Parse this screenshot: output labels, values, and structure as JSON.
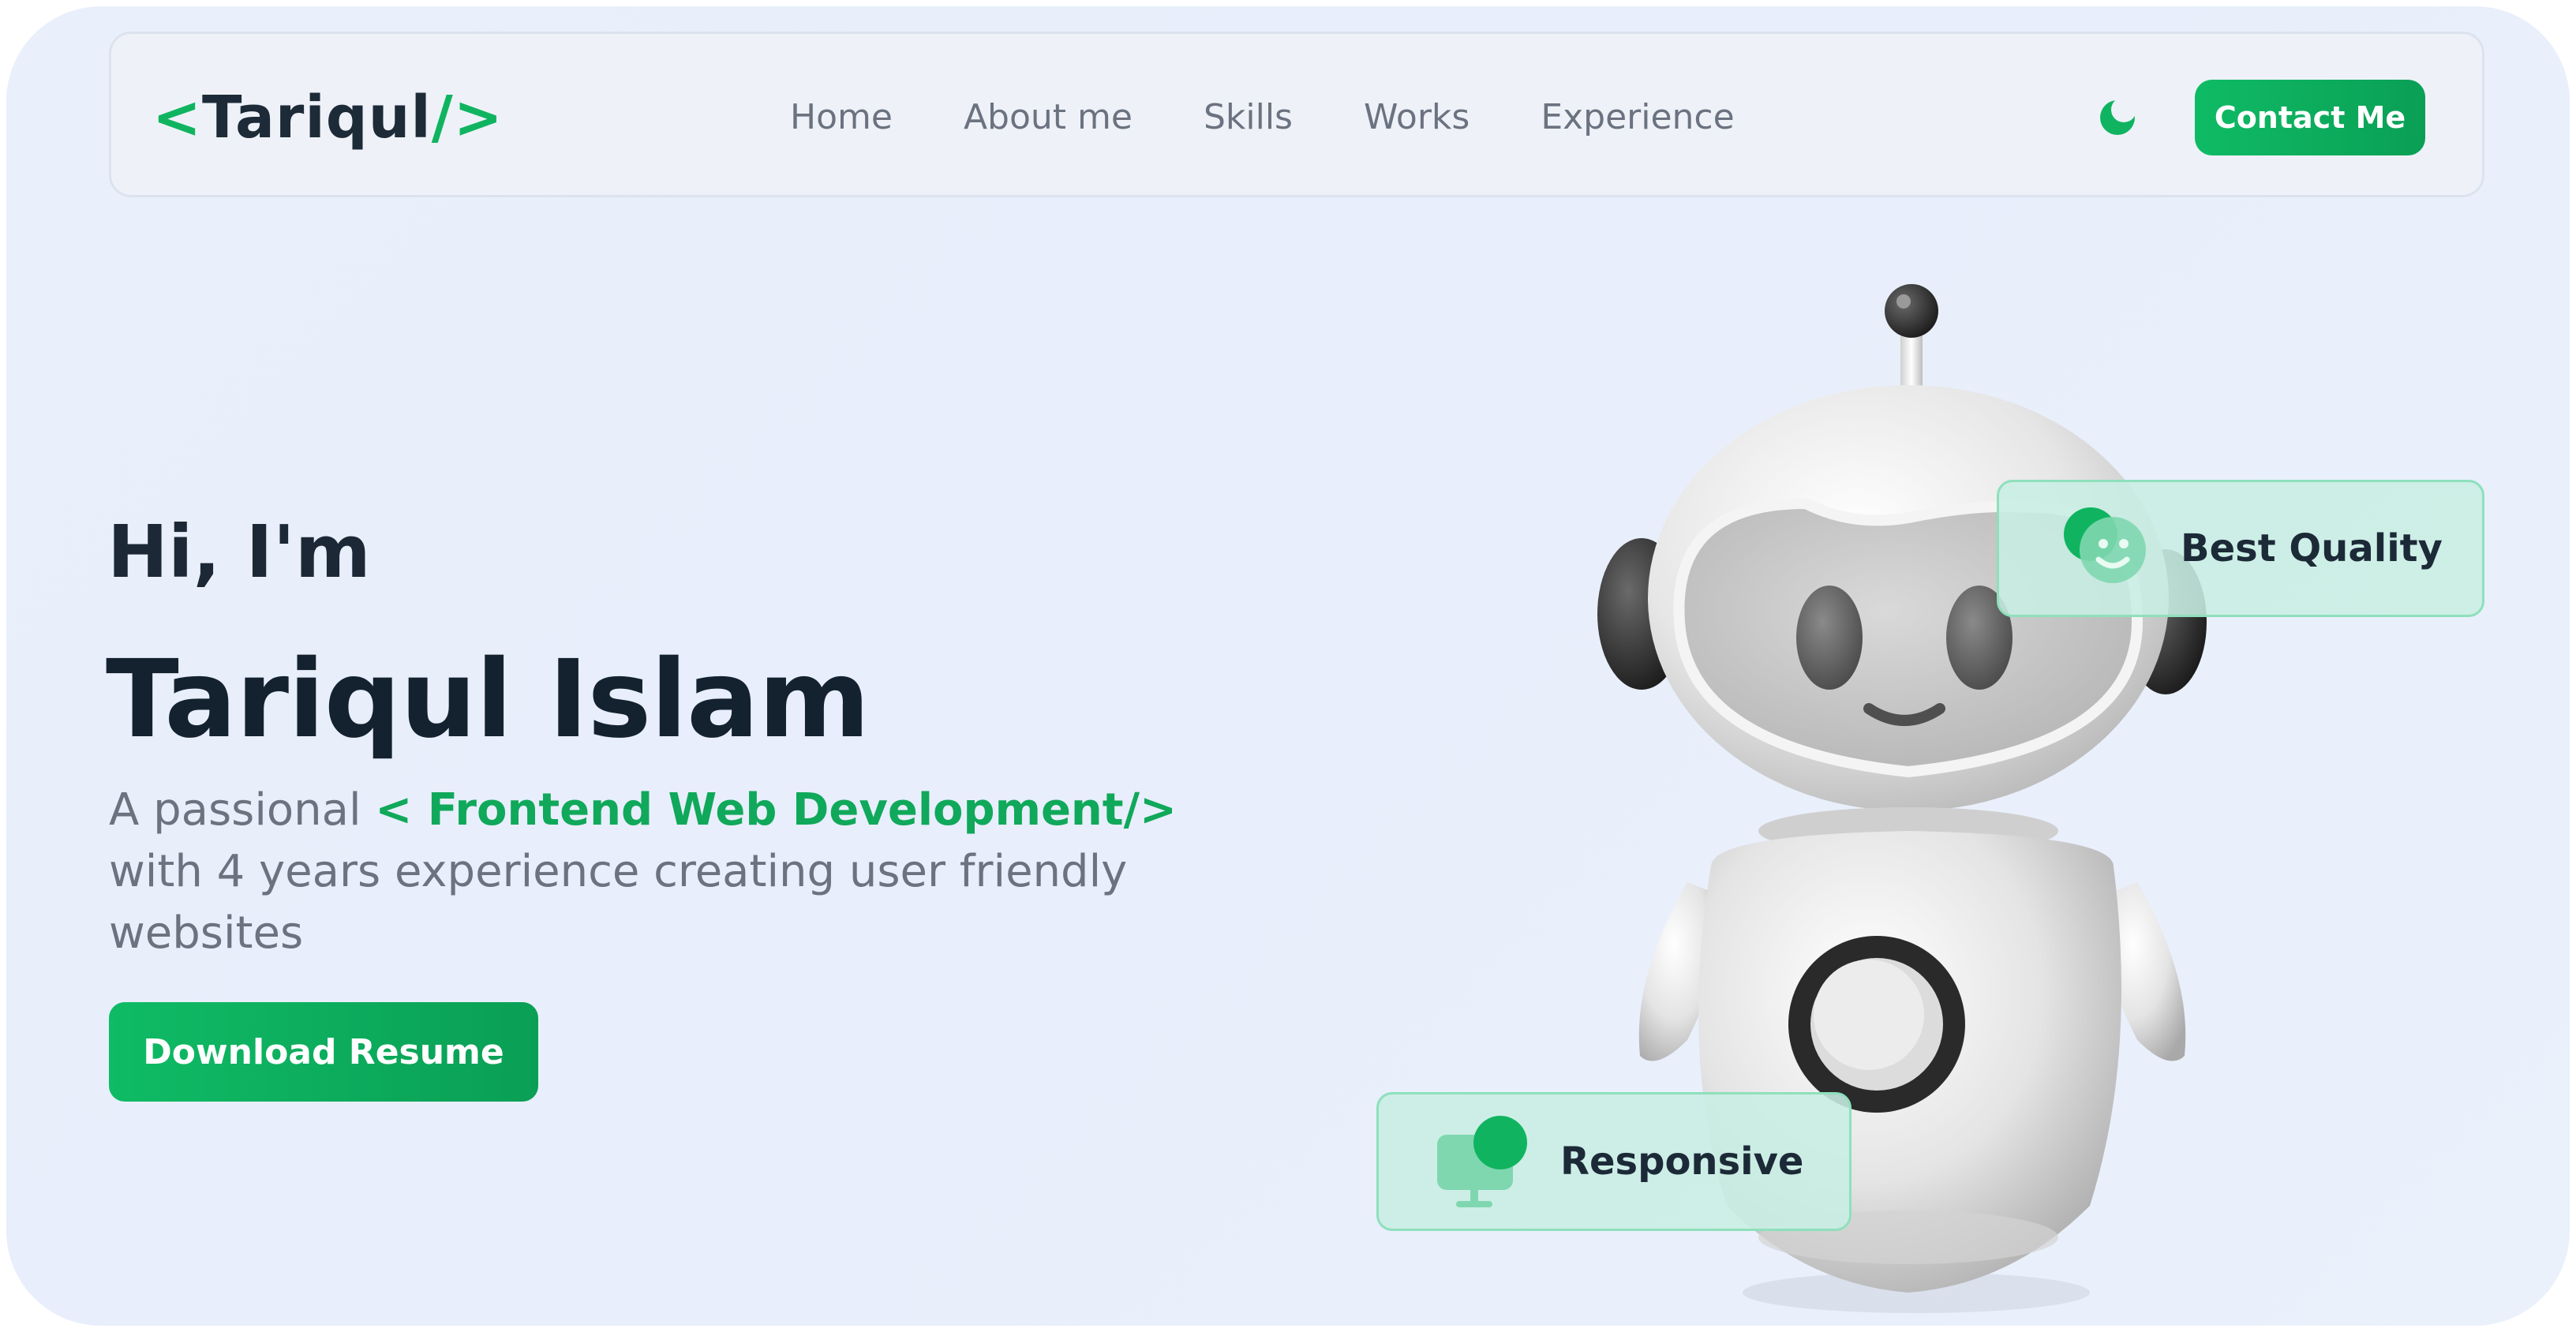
{
  "nav": {
    "logo": {
      "open": "<",
      "text": "Tariqul",
      "close": "/>"
    },
    "links": [
      "Home",
      "About me",
      "Skills",
      "Works",
      "Experience"
    ],
    "theme_icon": "moon-icon",
    "contact_label": "Contact Me"
  },
  "hero": {
    "greeting": "Hi, I'm",
    "name": "Tariqul Islam",
    "desc_prefix": "A passional ",
    "desc_highlight": "< Frontend Web Development/>",
    "desc_suffix": " with 4 years experience creating user friendly websites",
    "download_label": "Download Resume"
  },
  "badges": {
    "quality": {
      "label": "Best Quality",
      "icon": "smile-badge-icon"
    },
    "responsive": {
      "label": "Responsive",
      "icon": "monitor-badge-icon"
    }
  },
  "colors": {
    "accent": "#10b460",
    "accent_dark": "#0a9f55",
    "text_dark": "#142230",
    "text_muted": "#6b7280",
    "background": "#e9f0fb",
    "badge_bg": "#c8eee2"
  }
}
